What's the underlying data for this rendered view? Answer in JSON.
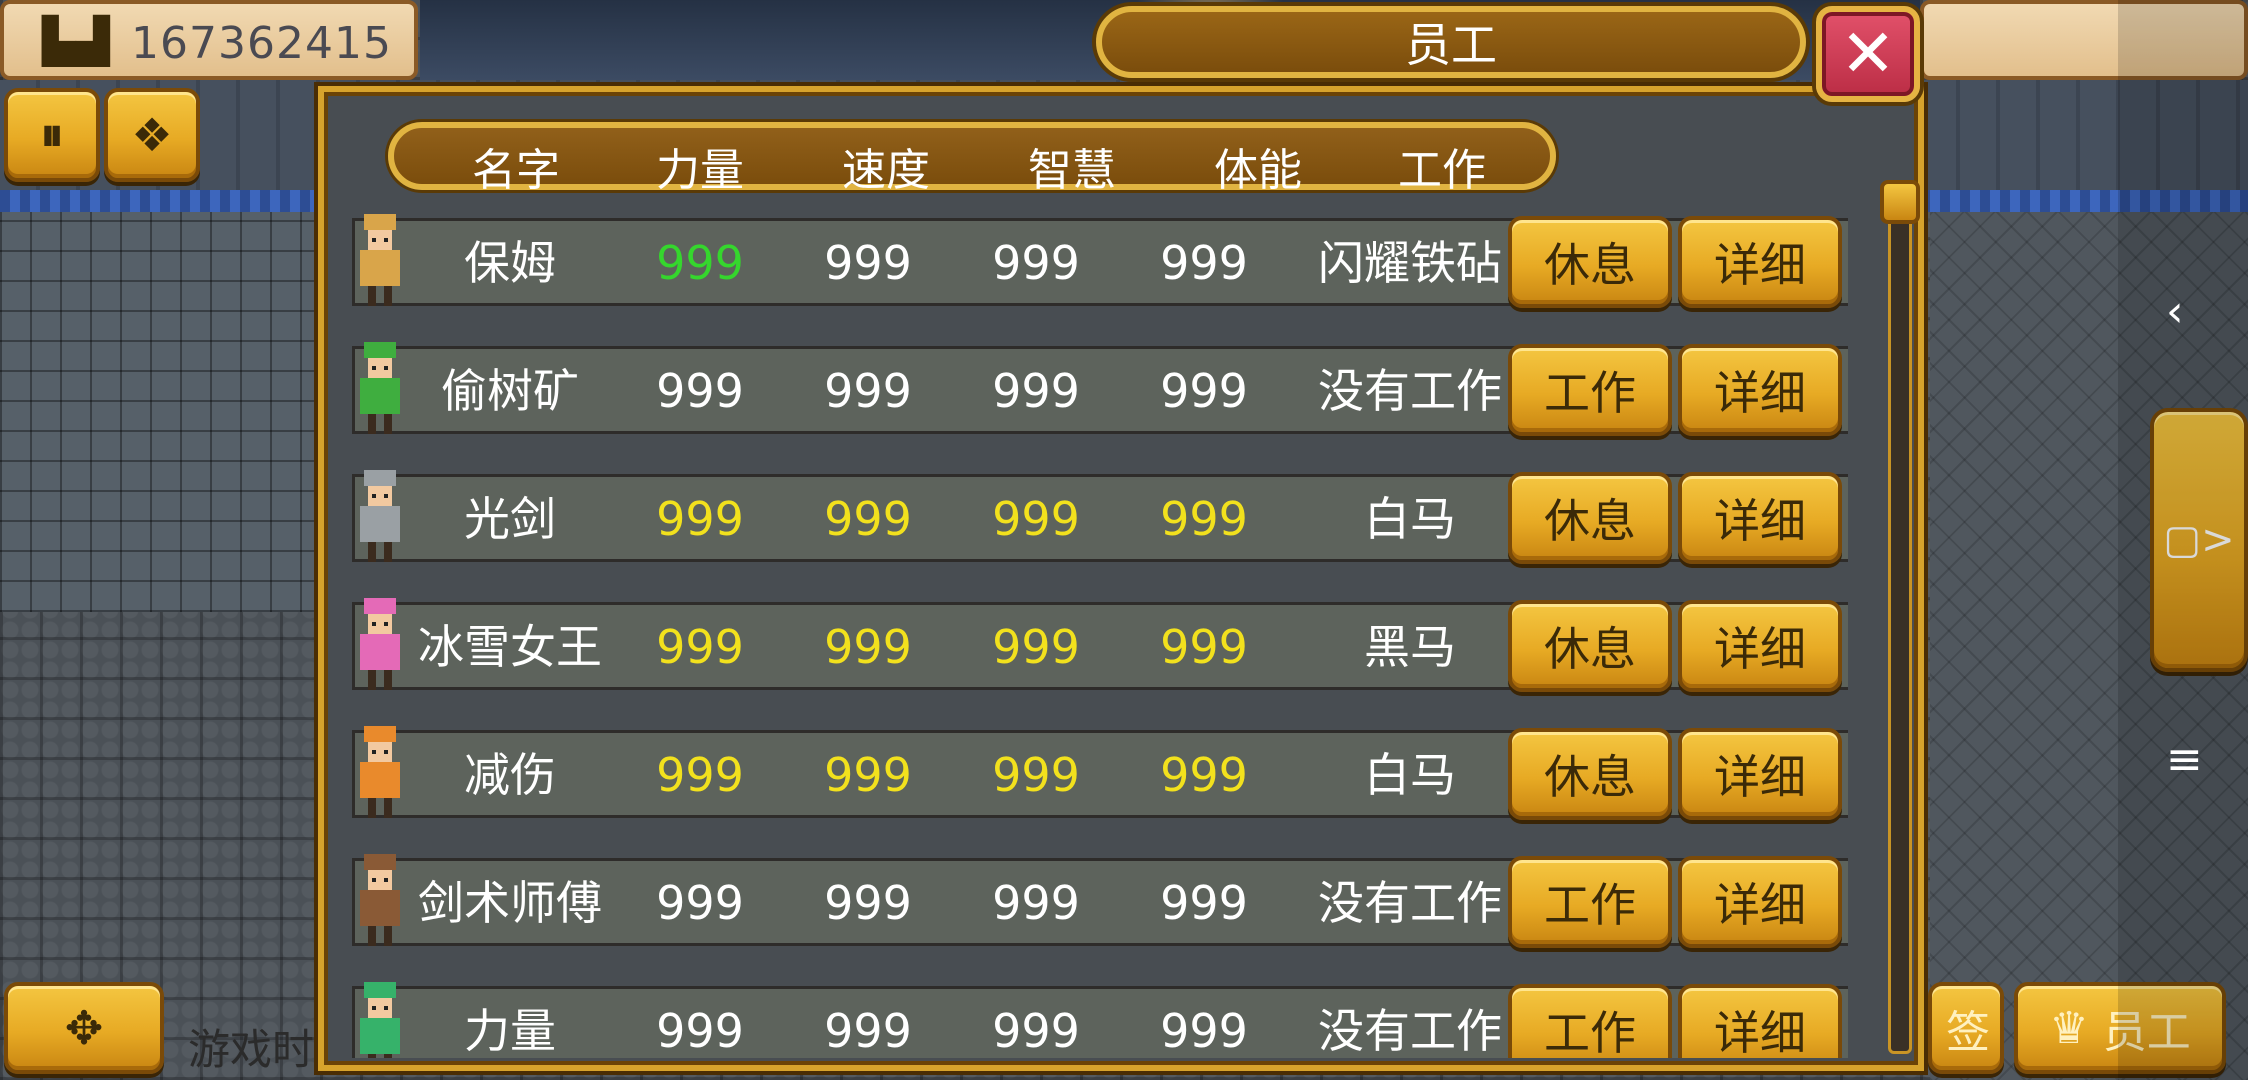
{
  "colors": {
    "gold": "#e7aa24",
    "gold_border": "#7a4a08",
    "panel_bg": "#484d52",
    "row_bg": "#5d635c",
    "title_brown": "#7b4d0c",
    "close_red": "#bb2d45",
    "stat_white": "#ffffff",
    "stat_yellow": "#f2e11d",
    "stat_green": "#35d62d"
  },
  "top_bar": {
    "money_icon": "gold-bars-icon",
    "money_value": "167362415"
  },
  "top_left_buttons": [
    {
      "name": "pause-button",
      "icon": "pause-icon",
      "glyph": "⏸"
    },
    {
      "name": "gems-button",
      "icon": "gems-icon",
      "glyph": "❖"
    }
  ],
  "panel": {
    "title": "员工",
    "close_icon": "close-icon",
    "close_glyph": "✕"
  },
  "columns": [
    "名字",
    "力量",
    "速度",
    "智慧",
    "体能",
    "工作"
  ],
  "rows": [
    {
      "name": "保姆",
      "stats": [
        "999",
        "999",
        "999",
        "999"
      ],
      "stat_colors": [
        "#35d62d",
        "#ffffff",
        "#ffffff",
        "#ffffff"
      ],
      "job": "闪耀铁砧",
      "action": "休息",
      "detail": "详细",
      "avatar": "golden-knight-avatar",
      "avatar_color": "#d9a54a"
    },
    {
      "name": "偷树矿",
      "stats": [
        "999",
        "999",
        "999",
        "999"
      ],
      "stat_colors": [
        "#ffffff",
        "#ffffff",
        "#ffffff",
        "#ffffff"
      ],
      "job": "没有工作",
      "action": "工作",
      "detail": "详细",
      "avatar": "green-goblin-avatar",
      "avatar_color": "#3fae3f"
    },
    {
      "name": "光剑",
      "stats": [
        "999",
        "999",
        "999",
        "999"
      ],
      "stat_colors": [
        "#f2e11d",
        "#f2e11d",
        "#f2e11d",
        "#f2e11d"
      ],
      "job": "白马",
      "action": "休息",
      "detail": "详细",
      "avatar": "gray-monk-avatar",
      "avatar_color": "#9aa0a4"
    },
    {
      "name": "冰雪女王",
      "stats": [
        "999",
        "999",
        "999",
        "999"
      ],
      "stat_colors": [
        "#f2e11d",
        "#f2e11d",
        "#f2e11d",
        "#f2e11d"
      ],
      "job": "黑马",
      "action": "休息",
      "detail": "详细",
      "avatar": "pink-hair-girl-avatar",
      "avatar_color": "#e46ab7"
    },
    {
      "name": "减伤",
      "stats": [
        "999",
        "999",
        "999",
        "999"
      ],
      "stat_colors": [
        "#f2e11d",
        "#f2e11d",
        "#f2e11d",
        "#f2e11d"
      ],
      "job": "白马",
      "action": "休息",
      "detail": "详细",
      "avatar": "orange-hair-mage-avatar",
      "avatar_color": "#e98a2c"
    },
    {
      "name": "剑术师傅",
      "stats": [
        "999",
        "999",
        "999",
        "999"
      ],
      "stat_colors": [
        "#ffffff",
        "#ffffff",
        "#ffffff",
        "#ffffff"
      ],
      "job": "没有工作",
      "action": "工作",
      "detail": "详细",
      "avatar": "brown-hair-swordsman-avatar",
      "avatar_color": "#8a5a36"
    },
    {
      "name": "力量",
      "stats": [
        "999",
        "999",
        "999",
        "999"
      ],
      "stat_colors": [
        "#ffffff",
        "#ffffff",
        "#ffffff",
        "#ffffff"
      ],
      "job": "没有工作",
      "action": "工作",
      "detail": "详细",
      "avatar": "green-hair-girl-avatar",
      "avatar_color": "#36b26a"
    }
  ],
  "bottom": {
    "dpad_icon": "dpad-icon",
    "dpad_glyph": "✥",
    "partial_text": "游戏时",
    "partial_right_text": "签",
    "staff_button_label": "员工",
    "staff_icon": "crown-icon",
    "staff_glyph": "♛"
  },
  "side": {
    "expand_icon": "expand-icon",
    "expand_glyph": "▢>"
  },
  "system_nav": {
    "back_glyph": "‹",
    "menu_glyph": "≡"
  }
}
